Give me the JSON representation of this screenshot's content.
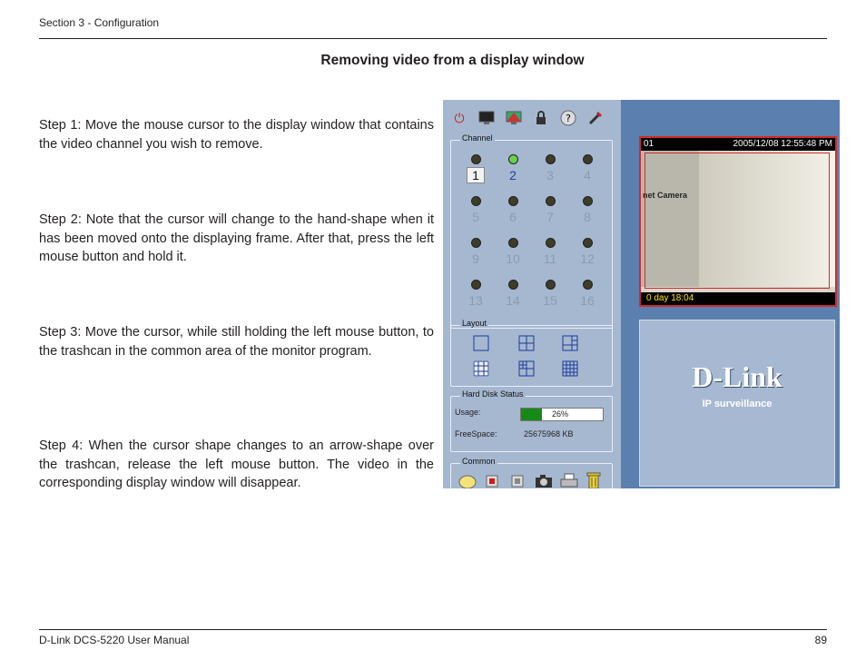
{
  "header": {
    "section": "Section 3 - Configuration"
  },
  "title": "Removing video from a display window",
  "steps": [
    "Step 1: Move the mouse cursor to the display window that contains the video channel you wish to remove.",
    "Step 2: Note that the cursor will change to the hand-shape when it has been moved onto the displaying frame. After that, press the left mouse button and hold it.",
    "Step 3: Move the cursor, while still holding the left mouse button, to the trashcan in the common area of the monitor program.",
    "Step 4: When the cursor shape changes to an arrow-shape over the trashcan, release the left mouse button. The video in the corresponding display window will disappear."
  ],
  "screenshot": {
    "channel_label": "Channel",
    "channels": [
      "1",
      "2",
      "3",
      "4",
      "5",
      "6",
      "7",
      "8",
      "9",
      "10",
      "11",
      "12",
      "13",
      "14",
      "15",
      "16"
    ],
    "layout_label": "Layout",
    "hdd_label": "Hard Disk Status",
    "usage_label": "Usage:",
    "usage_value": "26%",
    "usage_fraction": 0.26,
    "freespace_label": "FreeSpace:",
    "freespace_value": "25675968 KB",
    "common_label": "Common",
    "camera": {
      "channel": "01",
      "timestamp": "2005/12/08 12:55:48 PM",
      "uptime": "0 day  18:04",
      "sign_text": "net Camera"
    },
    "brand": {
      "logo": "D-Link",
      "tagline": "IP surveillance"
    }
  },
  "footer": {
    "manual": "D-Link DCS-5220 User Manual",
    "page": "89"
  }
}
